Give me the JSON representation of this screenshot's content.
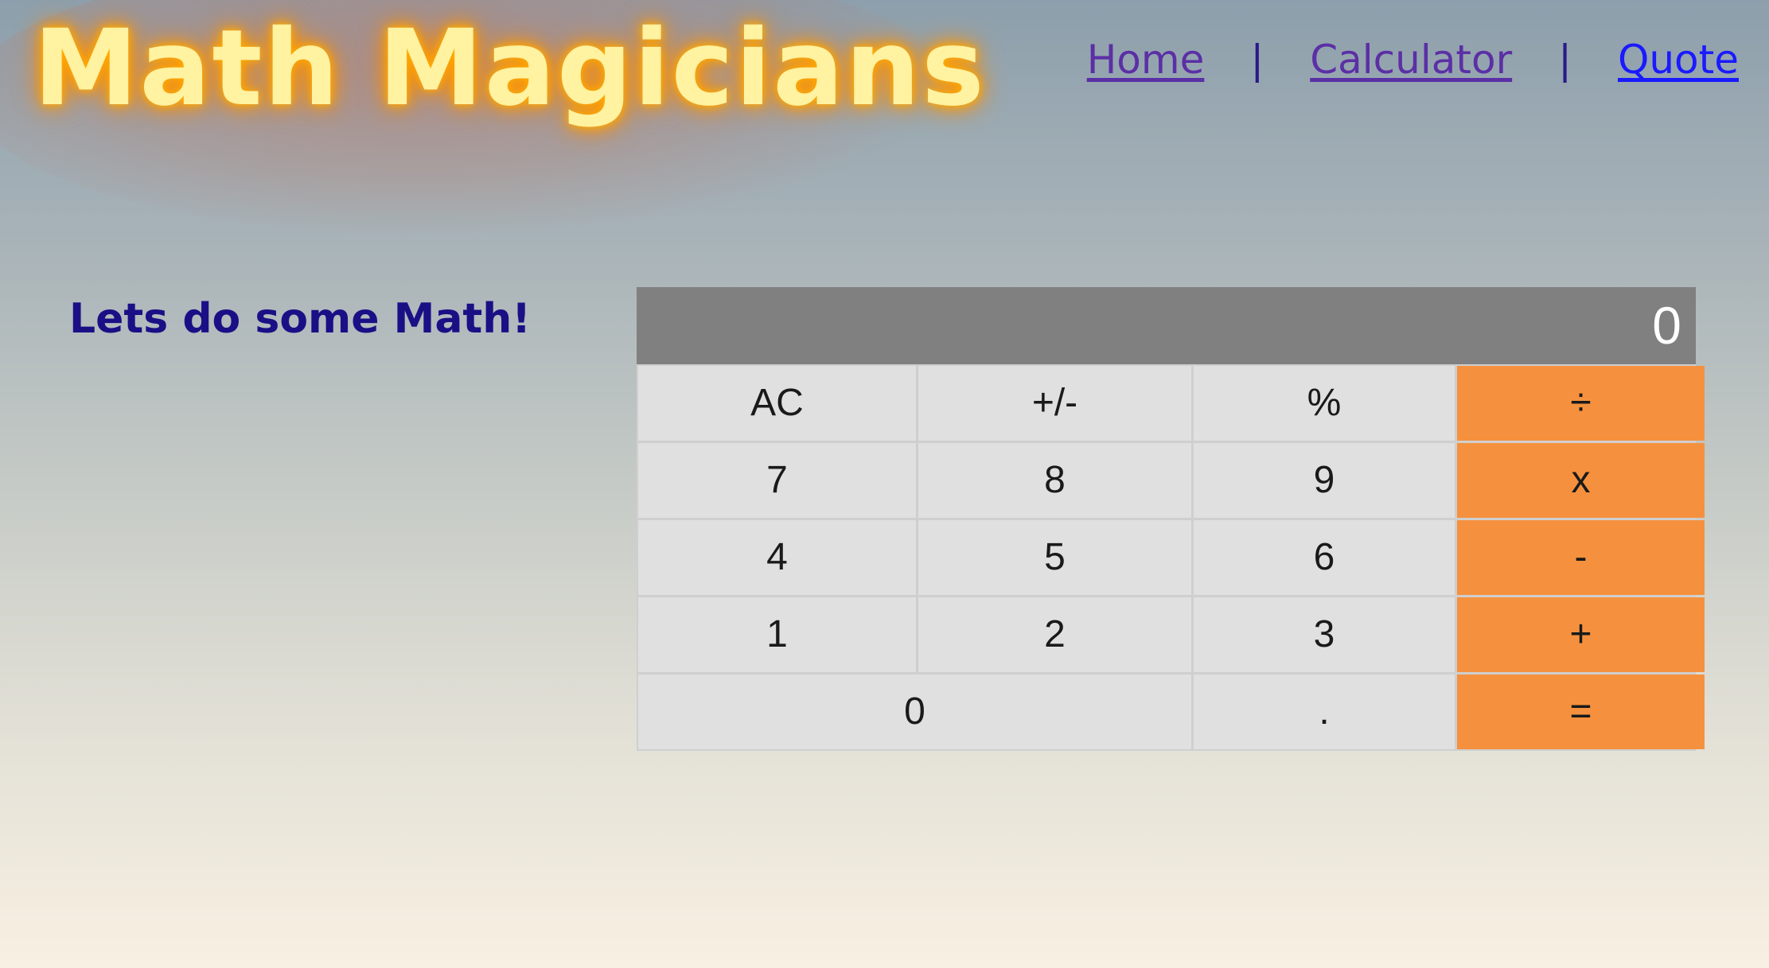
{
  "header": {
    "logo": "Math Magicians",
    "nav": [
      {
        "label": "Home",
        "style": "visited"
      },
      {
        "label": "Calculator",
        "style": "visited"
      },
      {
        "label": "Quote",
        "style": "link"
      }
    ],
    "separator": "|"
  },
  "main": {
    "tagline": "Lets do some Math!"
  },
  "calculator": {
    "display": "0",
    "keys": [
      "AC",
      "+/-",
      "%",
      "÷",
      "7",
      "8",
      "9",
      "x",
      "4",
      "5",
      "6",
      "-",
      "1",
      "2",
      "3",
      "+",
      "0",
      ".",
      "="
    ],
    "colors": {
      "display_bg": "#808080",
      "key_bg": "#e0e0e0",
      "operator_bg": "#f5913e",
      "tagline": "#1b0f86",
      "logo": "#fff2a0"
    }
  }
}
